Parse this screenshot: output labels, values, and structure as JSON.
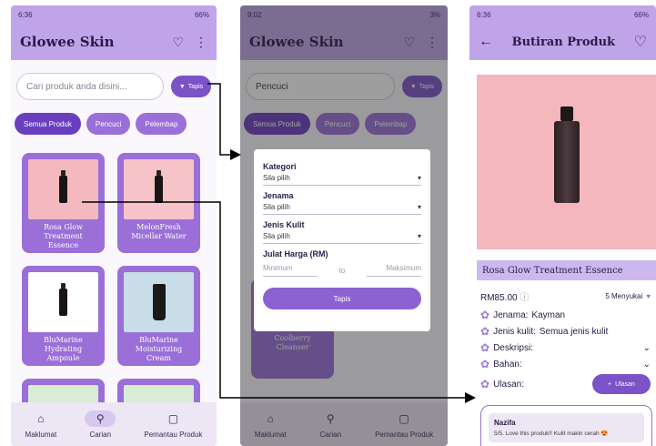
{
  "phone1": {
    "status_time": "6:36",
    "status_battery": "66%",
    "brand": "Glowee Skin",
    "search_placeholder": "Cari produk anda disini...",
    "filter_label": "Tapis",
    "chips": [
      "Semua Produk",
      "Pencuci",
      "Pelembap"
    ],
    "products": [
      {
        "name": "Rosa Glow Treatment Essence",
        "bg": "#f4b9bf"
      },
      {
        "name": "MelonFresh Micellar Water",
        "bg": "#f6c3c8"
      },
      {
        "name": "BluMarine Hydrating Ampoule",
        "bg": "#ffffff"
      },
      {
        "name": "BluMarine Moisturizing Cream",
        "bg": "#c9dde8"
      }
    ],
    "nav": [
      "Maklumat",
      "Carian",
      "Pemantau Produk"
    ]
  },
  "phone2": {
    "status_time": "9:02",
    "status_battery": "3%",
    "brand": "Glowee Skin",
    "search_value": "Pencuci",
    "filter_label": "Tapis",
    "chips": [
      "Semua Produk",
      "Pencuci",
      "Pelembap"
    ],
    "dialog": {
      "kategori_label": "Kategori",
      "kategori_value": "Sila pilih",
      "jenama_label": "Jenama",
      "jenama_value": "Sila pilih",
      "kulit_label": "Jenis Kulit",
      "kulit_value": "Sila pilih",
      "harga_label": "Julat Harga (RM)",
      "min_placeholder": "Minimum",
      "to_label": "to",
      "max_placeholder": "Maksimum",
      "apply_label": "Tapis"
    },
    "behind_product": "Coolberry Cleanser",
    "nav": [
      "Maklumat",
      "Carian",
      "Pemantau Produk"
    ]
  },
  "phone3": {
    "status_time": "6:36",
    "status_battery": "66%",
    "title": "Butiran Produk",
    "product_name": "Rosa Glow Treatment Essence",
    "price": "RM85.00",
    "likes": "5 Menyukai",
    "jenama_label": "Jenama:",
    "jenama_value": "Kayman",
    "kulit_label": "Jenis kulit:",
    "kulit_value": "Semua jenis kulit",
    "deskripsi_label": "Deskripsi:",
    "bahan_label": "Bahan:",
    "ulasan_label": "Ulasan:",
    "add_review_label": "Ulasan",
    "review": {
      "name": "Nazifa",
      "text": "5/5. Love this produk!! Kulit makin cerah 😍"
    }
  },
  "colors": {
    "primary": "#7b52c7",
    "header": "#bfa4ea",
    "card": "#9a6fd8"
  }
}
